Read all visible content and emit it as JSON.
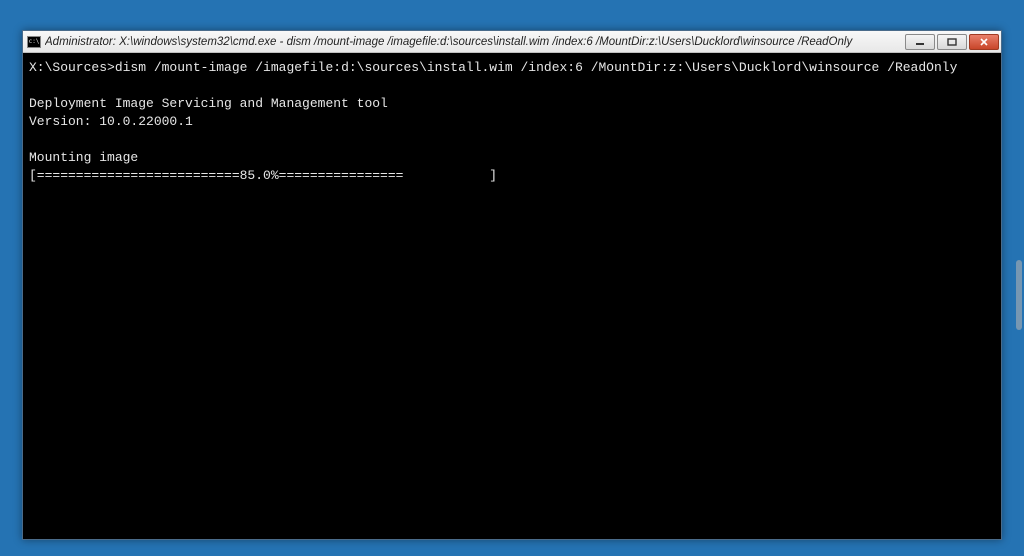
{
  "window": {
    "title": "Administrator: X:\\windows\\system32\\cmd.exe - dism  /mount-image /imagefile:d:\\sources\\install.wim /index:6 /MountDir:z:\\Users\\Ducklord\\winsource /ReadOnly"
  },
  "console": {
    "prompt": "X:\\Sources>",
    "command": "dism /mount-image /imagefile:d:\\sources\\install.wim /index:6 /MountDir:z:\\Users\\Ducklord\\winsource /ReadOnly",
    "tool_heading": "Deployment Image Servicing and Management tool",
    "version_line": "Version: 10.0.22000.1",
    "status_line": "Mounting image",
    "progress_line": "[==========================85.0%================           ]"
  },
  "buttons": {
    "minimize_tip": "Minimize",
    "maximize_tip": "Maximize",
    "close_tip": "Close"
  }
}
